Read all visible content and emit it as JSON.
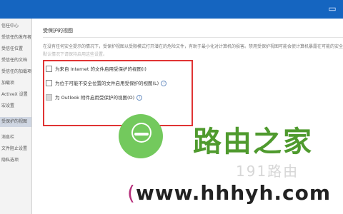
{
  "topbar": {
    "icon": "window-icon",
    "glyph": "▭"
  },
  "sidebar": {
    "items": [
      {
        "label": "信任中心",
        "selected": false
      },
      {
        "label": "受信任的发布者",
        "selected": false
      },
      {
        "label": "受信任位置",
        "selected": false
      },
      {
        "label": "受信任的文档",
        "selected": false
      },
      {
        "label": "受信任的加载项目录",
        "selected": false
      },
      {
        "label": "加载项",
        "selected": false
      },
      {
        "label": "ActiveX 设置",
        "selected": false
      },
      {
        "label": "宏设置",
        "selected": false
      },
      {
        "label": "受保护的视图",
        "selected": true
      },
      {
        "label": "消息栏",
        "selected": false
      },
      {
        "label": "文件阻止设置",
        "selected": false
      },
      {
        "label": "隐私选项",
        "selected": false
      }
    ]
  },
  "protected_view": {
    "title": "受保护的视图",
    "description": "在没有任何安全提示的情况下，受保护视图以受限模式打开潜在的危险文件，有助于最小化对计算机的损害。禁用受保护视图可能会使计算机暴露在可能的安全威胁中。",
    "description_line2": "默认情况下请保持启用这些设置。",
    "options": [
      {
        "label": "为来自 Internet 的文件启用受保护的视图(I)",
        "checked": false,
        "disabled": false
      },
      {
        "label": "为位于可能不安全位置的文件启用受保护的视图(L)",
        "checked": false,
        "disabled": false
      },
      {
        "label": "为 Outlook 附件启用受保护的视图(O)",
        "checked": false,
        "disabled": true
      }
    ],
    "info_glyph": "i"
  },
  "watermark": {
    "brand_cn": "路由之家",
    "url_paren": "(",
    "url": "www.hhhyh.com",
    "faint_text": "191路由"
  },
  "colors": {
    "accent": "#1565c0",
    "highlight_border": "#e03434",
    "logo_green": "#73c95d",
    "brand_green": "#4f9a2e"
  }
}
